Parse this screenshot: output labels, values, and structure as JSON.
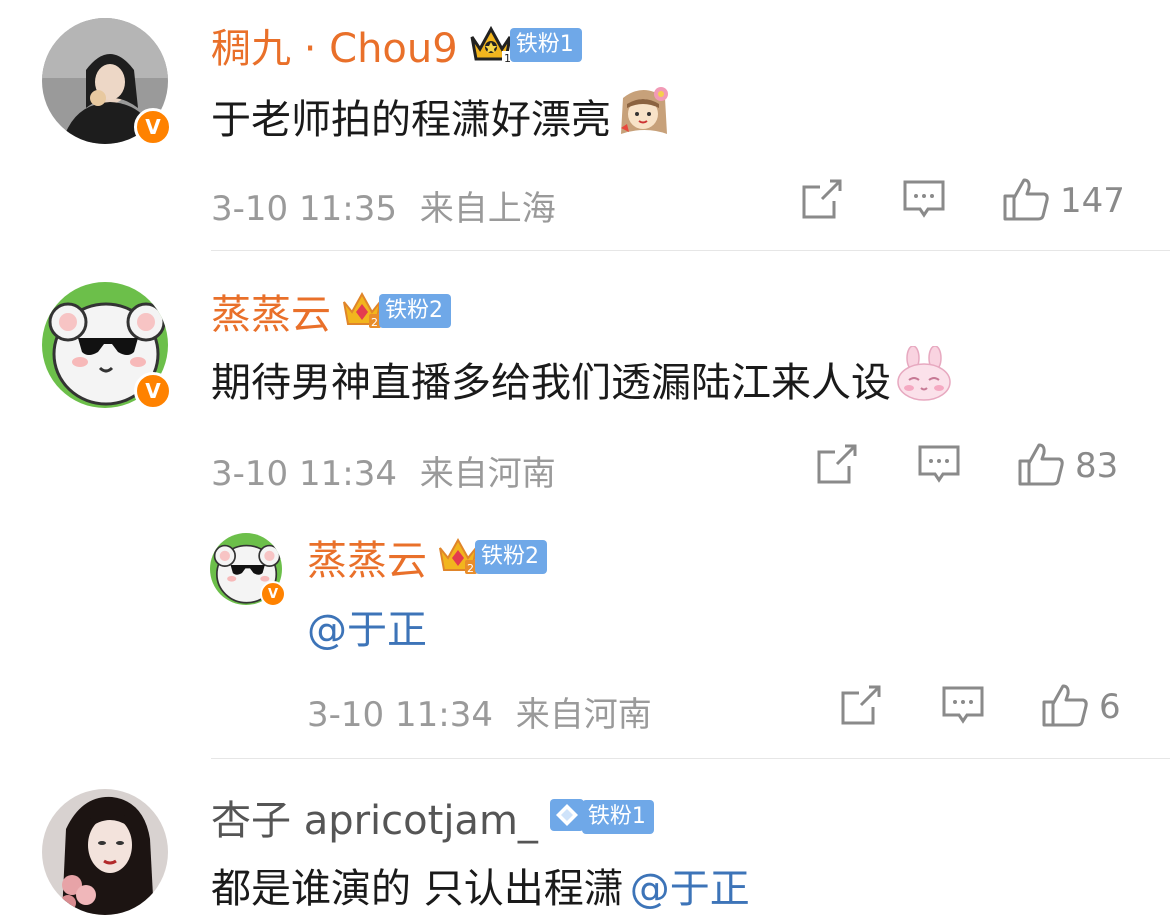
{
  "comments": [
    {
      "user": "稠九 · Chou9",
      "fan_badge": "铁粉1",
      "text": "于老师拍的程潇好漂亮",
      "time": "3-10 11:35",
      "location": "来自上海",
      "likes": "147"
    },
    {
      "user": "蒸蒸云",
      "fan_badge": "铁粉2",
      "text": "期待男神直播多给我们透漏陆江来人设",
      "time": "3-10 11:34",
      "location": "来自河南",
      "likes": "83",
      "reply": {
        "user": "蒸蒸云",
        "fan_badge": "铁粉2",
        "text": "@于正",
        "time": "3-10 11:34",
        "location": "来自河南",
        "likes": "6"
      }
    },
    {
      "user": "杏子 apricotjam_",
      "fan_badge": "铁粉1",
      "text_plain": "都是谁演的 只认出程潇",
      "mention": "@于正"
    }
  ],
  "icons": {
    "share": "share-icon",
    "comment": "comment-icon",
    "like": "thumbs-up-icon",
    "verified": "verified-v-icon",
    "crown": "crown-icon",
    "diamond": "diamond-icon"
  },
  "colors": {
    "username_orange": "#e9702a",
    "mention_blue": "#3d74b8",
    "fan_badge_blue": "#6fa8e8",
    "verified_orange": "#ff8200",
    "meta_gray": "#9a9a9a"
  }
}
